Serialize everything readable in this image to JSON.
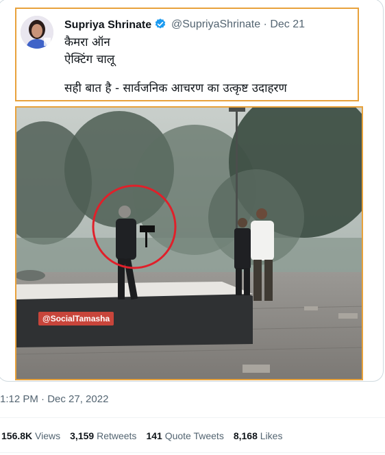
{
  "quoted_tweet": {
    "display_name": "Supriya Shrinate",
    "handle": "@SupriyaShrinate",
    "date": "Dec 21",
    "line1": "कैमरा ऑन",
    "line2": "ऐक्टिंग चालू",
    "line3": "सही बात है - सार्वजनिक आचरण का उत्कृष्ट उदाहरण",
    "verified_color": "#1d9bf0"
  },
  "video": {
    "watermark": "@SocialTamasha",
    "highlight_color": "#e0202a",
    "frame_border_color": "#e8a13a"
  },
  "tweet_meta": {
    "timestamp": "1:12 PM · Dec 27, 2022"
  },
  "stats": {
    "views_count": "156.8K",
    "views_label": "Views",
    "retweets_count": "3,159",
    "retweets_label": "Retweets",
    "quotes_count": "141",
    "quotes_label": "Quote Tweets",
    "likes_count": "8,168",
    "likes_label": "Likes"
  }
}
